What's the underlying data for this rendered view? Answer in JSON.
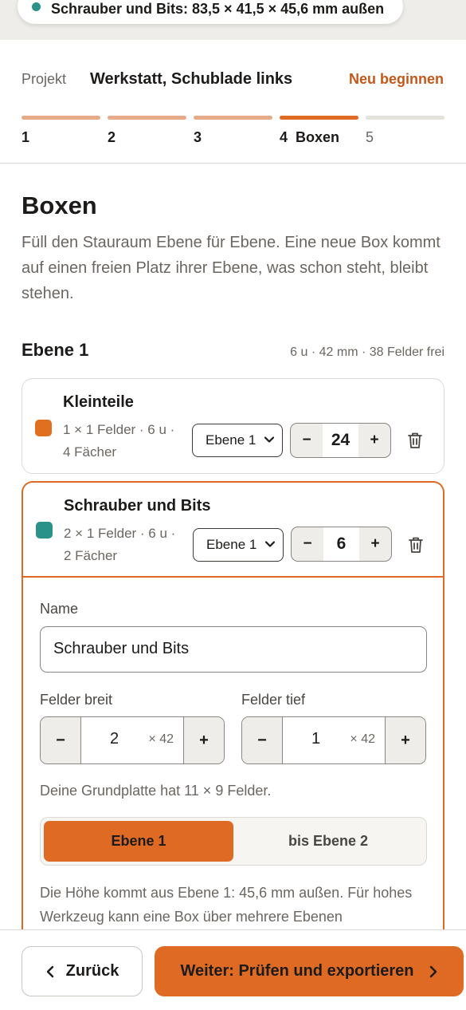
{
  "top_pill": {
    "text": "Schrauber und Bits: 83,5 × 41,5 × 45,6 mm außen"
  },
  "project": {
    "label": "Projekt",
    "name": "Werkstatt, Schublade links",
    "restart": "Neu beginnen"
  },
  "steps": [
    {
      "label": "1",
      "state": "done"
    },
    {
      "label": "2",
      "state": "done"
    },
    {
      "label": "3",
      "state": "done"
    },
    {
      "label": "4  Boxen",
      "state": "active"
    },
    {
      "label": "5",
      "state": "todo"
    }
  ],
  "page": {
    "title": "Boxen",
    "intro": "Füll den Stauraum Ebene für Ebene. Eine neue Box kommt auf einen freien Platz ihrer Ebene, was schon steht, bleibt stehen."
  },
  "level": {
    "title": "Ebene 1",
    "summary": "6 u · 42 mm · 38 Felder frei"
  },
  "boxes": [
    {
      "name": "Kleinteile",
      "color": "#e07020",
      "meta": "1 × 1 Felder · 6 u · 4 Fächer",
      "level": "Ebene 1",
      "count": "24",
      "minus": "−",
      "plus": "+"
    },
    {
      "name": "Schrauber und Bits",
      "color": "#2a9289",
      "meta": "2 × 1 Felder · 6 u · 2 Fächer",
      "level": "Ebene 1",
      "count": "6",
      "minus": "−",
      "plus": "+"
    }
  ],
  "editor": {
    "name_label": "Name",
    "name_value": "Schrauber und Bits",
    "width_label": "Felder breit",
    "width_value": "2",
    "width_unit": "× 42",
    "depth_label": "Felder tief",
    "depth_value": "1",
    "depth_unit": "× 42",
    "minus": "−",
    "plus": "+",
    "baseplate_hint": "Deine Grundplatte hat 11 × 9 Felder.",
    "height_options": [
      "Ebene 1",
      "bis Ebene 2"
    ],
    "height_selected": "Ebene 1",
    "note": "Die Höhe kommt aus Ebene 1: 45,6 mm außen. Für hohes Werkzeug kann eine Box über mehrere Ebenen"
  },
  "footer": {
    "back": "Zurück",
    "next": "Weiter: Prüfen und exportieren"
  },
  "colors": {
    "accent": "#df6a24",
    "accent_text": "#c4581a",
    "teal": "#2a9289"
  }
}
